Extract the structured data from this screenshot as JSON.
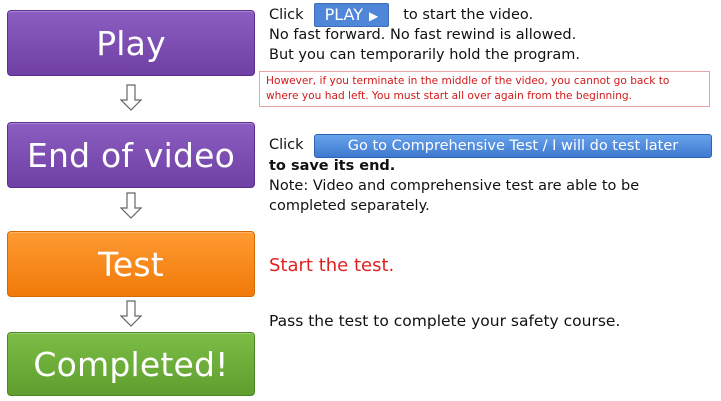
{
  "steps": {
    "play": "Play",
    "end_of_video": "End of video",
    "test": "Test",
    "completed": "Completed!"
  },
  "play_section": {
    "click": "Click",
    "play_button": "PLAY",
    "play_button_icon": "play-triangle-icon",
    "to_start": "to start the video.",
    "line2": "No fast forward. No fast rewind is allowed.",
    "line3": "But you can temporarily hold the program.",
    "notice_line1": "However, if you terminate in the middle of the video, you cannot go back to",
    "notice_line2": "where you had left. You must start all over again from the beginning."
  },
  "end_section": {
    "click": "Click",
    "button": "Go to Comprehensive Test / I will do test later",
    "save_end": "to save its end.",
    "note_line1": "Note: Video and comprehensive test are able to be",
    "note_line2": "completed separately."
  },
  "test_section": {
    "start": "Start the test."
  },
  "completed_section": {
    "text": "Pass the test to complete your safety course."
  },
  "colors": {
    "purple": "#7a4cb3",
    "orange": "#f7860f",
    "green": "#6aaa39",
    "red_text": "#e02020",
    "blue_button": "#4f86d7"
  }
}
